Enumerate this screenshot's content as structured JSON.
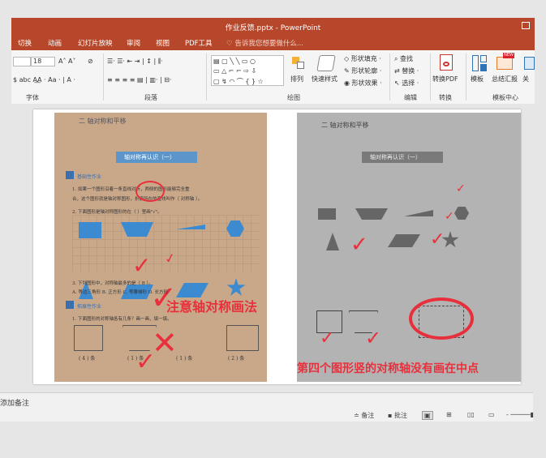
{
  "window": {
    "title": "作业反馈.pptx - PowerPoint"
  },
  "tabs": [
    "切换",
    "动画",
    "幻灯片放映",
    "审阅",
    "视图",
    "PDF工具"
  ],
  "tell_me": "告诉我您想要做什么...",
  "ribbon": {
    "font_size": "18",
    "groups": {
      "font": "字体",
      "paragraph": "段落",
      "drawing": "绘图",
      "editing": "编辑",
      "convert": "转换",
      "template": "模板中心"
    },
    "buttons": {
      "arrange": "排列",
      "quick_styles": "快速样式",
      "shape_fill": "形状填充",
      "shape_outline": "形状轮廓",
      "shape_effects": "形状效果",
      "find": "查找",
      "replace": "替换",
      "select": "选择",
      "convert_pdf": "转换PDF",
      "template": "模板",
      "summary_report": "总结汇报",
      "more": "关",
      "new_badge": "NEW"
    }
  },
  "slide": {
    "left_photo": {
      "section_title": "二 轴对称和平移",
      "banner": "轴对称再认识（一）",
      "basic": "基础性作业",
      "q1a": "1. 如果一个图形沿着一条直线对折，两侧的图形能够完全重",
      "q1b": "合，这个图形就是轴对称图形，折痕所在的直线叫作（ 对称轴 ）。",
      "q2": "2. 下面图形是轴对称图形的在（   ）里画\"√\"。",
      "q3": "3. 下列图形中，对称轴最多的是（ B ）。",
      "q3opts": "A. 等边三角形   B. 正方形   C. 等腰梯形   D. 长方形",
      "expand": "拓展性作业",
      "q4": "1. 下面图形的对称轴各有几条？画一画，填一填。",
      "ans": [
        "( 4 ) 条",
        "( 1 ) 条",
        "( 1 ) 条",
        "( 2 ) 条"
      ],
      "annotation": "注意轴对称画法"
    },
    "right_photo": {
      "section_title": "二 轴对称和平移",
      "banner": "轴对称再认识（一）",
      "annotation": "第四个图形竖的对称轴没有画在中点"
    }
  },
  "notes": {
    "placeholder": "单击此处添加备注",
    "visible_text": "添加备注"
  },
  "status": {
    "notes": "备注",
    "comments": "批注"
  },
  "colors": {
    "accent": "#b7472a",
    "annotation": "#e8303c"
  }
}
